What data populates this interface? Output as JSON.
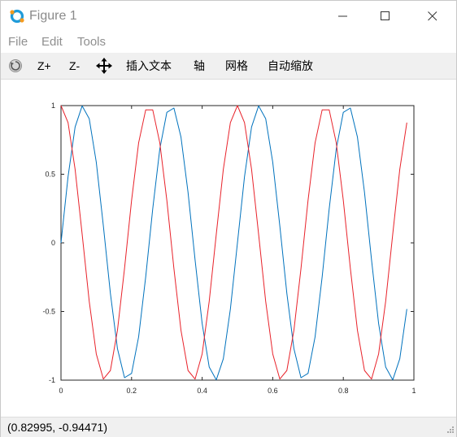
{
  "window": {
    "title": "Figure 1"
  },
  "menu": {
    "file": "File",
    "edit": "Edit",
    "tools": "Tools"
  },
  "toolbar": {
    "zoom_in": "Z+",
    "zoom_out": "Z-",
    "insert_text": "插入文本",
    "axis": "轴",
    "grid": "网格",
    "autoscale": "自动缩放"
  },
  "status": {
    "coordinates": "(0.82995, -0.94471)"
  },
  "chart_data": {
    "type": "line",
    "xlim": [
      0,
      1
    ],
    "ylim": [
      -1,
      1
    ],
    "xticks": [
      "0",
      "0.2",
      "0.4",
      "0.6",
      "0.8",
      "1"
    ],
    "yticks": [
      "1",
      "0.5",
      "0",
      "-0.5",
      "-1"
    ],
    "grid": false,
    "series": [
      {
        "function": "sin(8*pi*x)",
        "color": "#0072bd",
        "x_start": 0,
        "x_end": 0.98,
        "samples": 50
      },
      {
        "function": "cos(8*pi*x)",
        "color": "#e8222a",
        "x_start": 0,
        "x_end": 0.98,
        "samples": 50
      }
    ]
  }
}
